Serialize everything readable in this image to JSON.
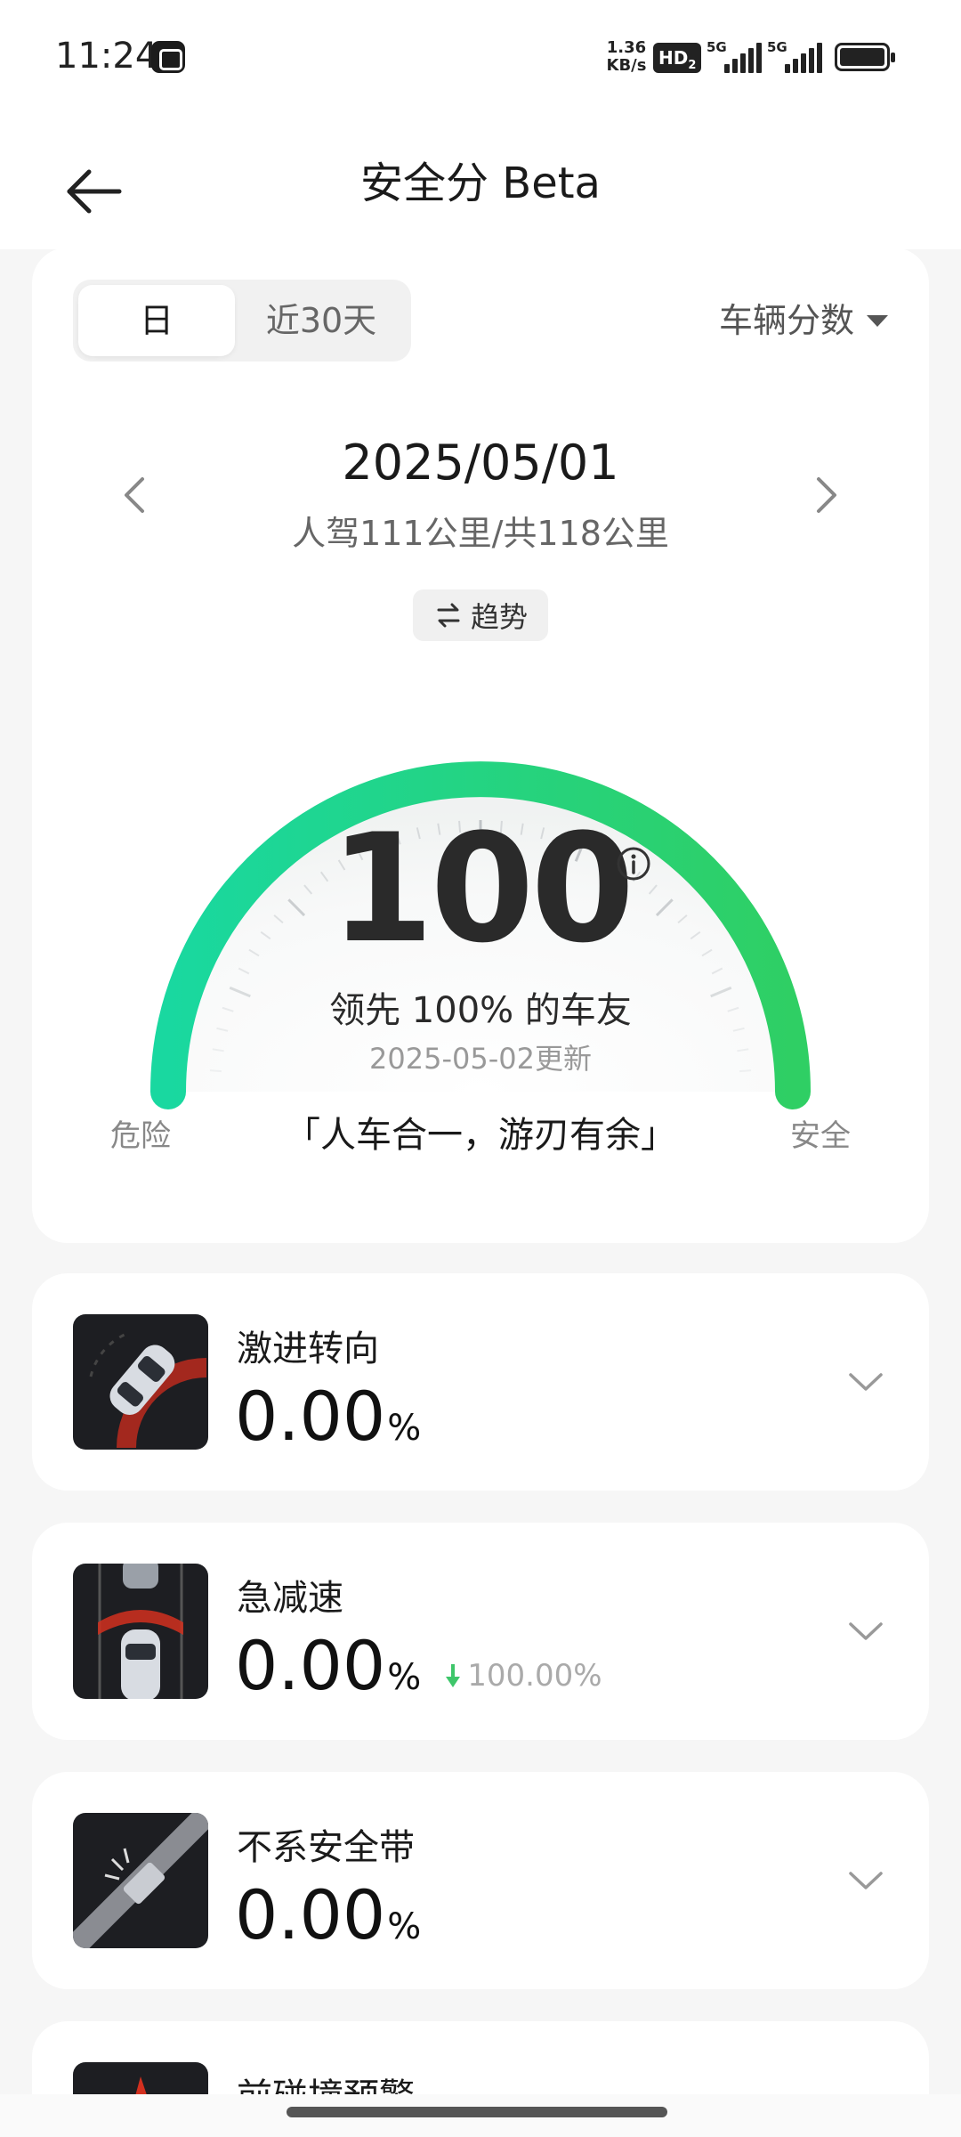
{
  "status_bar": {
    "time": "11:24",
    "net_speed_value": "1.36",
    "net_speed_unit": "KB/s",
    "hd_label": "HD",
    "hd_sub": "2",
    "sim1_label": "5G",
    "sim2_label": "5G",
    "battery_level": 1.0
  },
  "header": {
    "title": "安全分 Beta",
    "back_icon": "arrow-left-icon"
  },
  "score_card": {
    "tabs": [
      {
        "label": "日",
        "active": true
      },
      {
        "label": "近30天",
        "active": false
      }
    ],
    "vehicle_dropdown_label": "车辆分数",
    "date": "2025/05/01",
    "distance": "人驾111公里/共118公里",
    "trend_button_label": "趋势",
    "score": "100",
    "lead_text": "领先 100% 的车友",
    "update_text": "2025-05-02更新",
    "label_danger": "危险",
    "label_safe": "安全",
    "slogan": "「人车合一，游刃有余」",
    "gauge_level": 1.0,
    "gauge_colors": {
      "start": "#19d8a0",
      "end": "#2fcf64"
    }
  },
  "metrics": [
    {
      "name": "激进转向",
      "value": "0.00",
      "unit": "%",
      "change": "",
      "icon": "aggressive-steering-icon"
    },
    {
      "name": "急减速",
      "value": "0.00",
      "unit": "%",
      "change": "100.00%",
      "change_direction": "down",
      "change_color": "#3ec66a",
      "icon": "hard-braking-icon"
    },
    {
      "name": "不系安全带",
      "value": "0.00",
      "unit": "%",
      "change": "",
      "icon": "seatbelt-icon"
    },
    {
      "name": "前碰撞预警",
      "value": "",
      "unit": "",
      "change": "",
      "icon": "forward-collision-icon"
    }
  ]
}
